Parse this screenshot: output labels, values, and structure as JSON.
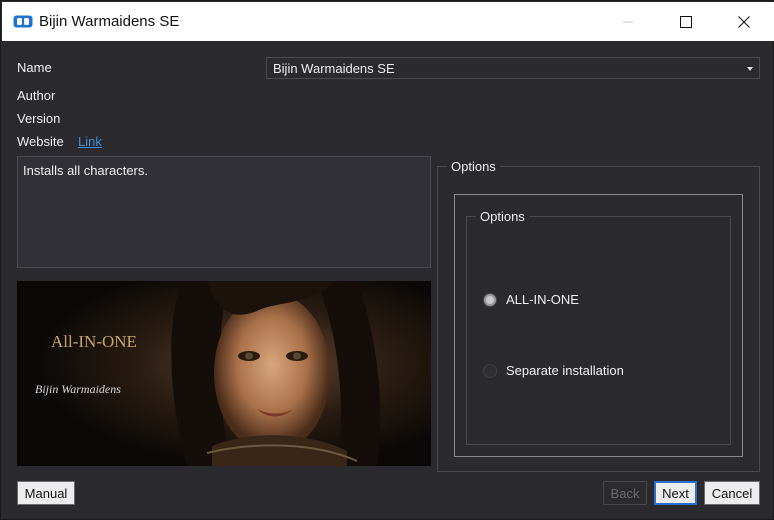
{
  "window": {
    "title": "Bijin Warmaidens SE",
    "controls": {
      "minimize": "minimize",
      "maximize": "maximize",
      "close": "close"
    }
  },
  "form": {
    "name_label": "Name",
    "name_value": "Bijin Warmaidens SE",
    "author_label": "Author",
    "author_value": "",
    "version_label": "Version",
    "version_value": "",
    "website_label": "Website",
    "website_link": "Link",
    "description": "Installs all characters."
  },
  "preview": {
    "overlay_title": "All-IN-ONE",
    "signature": "Bijin Warmaidens"
  },
  "options": {
    "outer_title": "Options",
    "inner_title": "Options",
    "choices": [
      {
        "label": "ALL-IN-ONE",
        "selected": true
      },
      {
        "label": "Separate installation",
        "selected": false
      }
    ]
  },
  "buttons": {
    "manual": "Manual",
    "back": "Back",
    "next": "Next",
    "cancel": "Cancel"
  },
  "colors": {
    "background": "#2b2b2f",
    "link": "#3d8fd8",
    "accent": "#2a6fd0"
  }
}
